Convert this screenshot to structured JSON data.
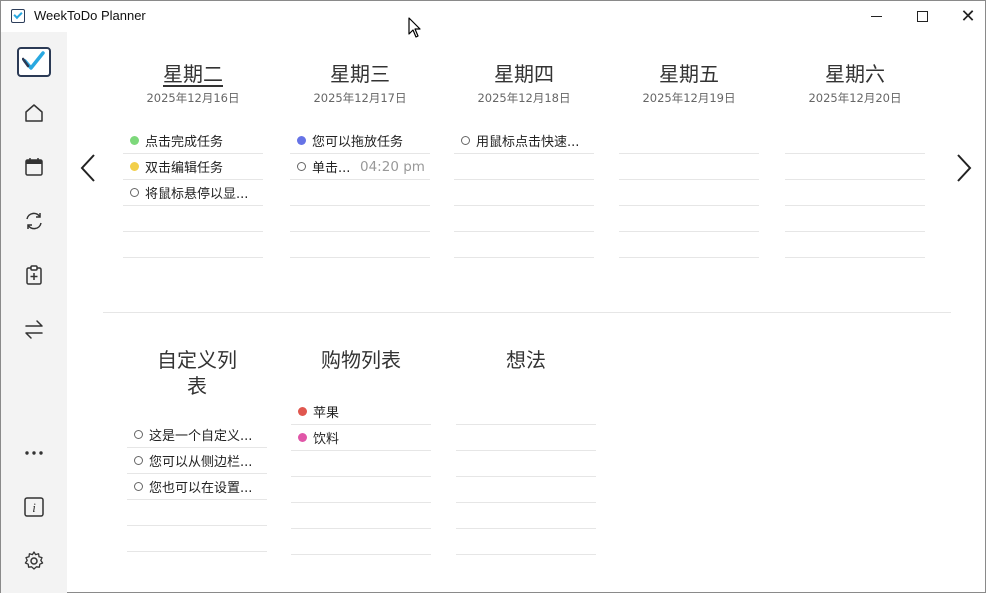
{
  "window": {
    "title": "WeekToDo Planner"
  },
  "sidebar": {
    "items": [
      {
        "name": "home-icon"
      },
      {
        "name": "calendar-icon"
      },
      {
        "name": "sync-icon"
      },
      {
        "name": "clipboard-add-icon"
      },
      {
        "name": "swap-arrows-icon"
      },
      {
        "name": "more-icon"
      },
      {
        "name": "info-icon"
      },
      {
        "name": "settings-icon"
      }
    ]
  },
  "week": {
    "days": [
      {
        "name": "星期二",
        "date": "2025年12月16日",
        "today": true,
        "tasks": [
          {
            "text": "点击完成任务",
            "marker": "dot",
            "color": "#7dd87b"
          },
          {
            "text": "双击编辑任务",
            "marker": "dot",
            "color": "#f2cf4a"
          },
          {
            "text": "将鼠标悬停以显...",
            "marker": "circle",
            "color": ""
          }
        ]
      },
      {
        "name": "星期三",
        "date": "2025年12月17日",
        "today": false,
        "tasks": [
          {
            "text": "您可以拖放任务",
            "marker": "dot",
            "color": "#6673e6"
          },
          {
            "text": "单击...",
            "marker": "circle",
            "color": "",
            "time": "04:20 pm"
          }
        ]
      },
      {
        "name": "星期四",
        "date": "2025年12月18日",
        "today": false,
        "tasks": [
          {
            "text": "用鼠标点击快速...",
            "marker": "circle",
            "color": ""
          }
        ]
      },
      {
        "name": "星期五",
        "date": "2025年12月19日",
        "today": false,
        "tasks": []
      },
      {
        "name": "星期六",
        "date": "2025年12月20日",
        "today": false,
        "tasks": []
      }
    ]
  },
  "lists": [
    {
      "name_line1": "自定义列",
      "name_line2": "表",
      "tasks": [
        {
          "text": "这是一个自定义...",
          "marker": "circle",
          "color": ""
        },
        {
          "text": "您可以从侧边栏...",
          "marker": "circle",
          "color": ""
        },
        {
          "text": "您也可以在设置...",
          "marker": "circle",
          "color": ""
        }
      ]
    },
    {
      "name_line1": "购物列表",
      "name_line2": "",
      "tasks": [
        {
          "text": "苹果",
          "marker": "dot",
          "color": "#e0574f"
        },
        {
          "text": "饮料",
          "marker": "dot",
          "color": "#e056a8"
        }
      ]
    },
    {
      "name_line1": "想法",
      "name_line2": "",
      "tasks": []
    }
  ],
  "colors": {
    "sidebar_bg": "#f3f3f3",
    "logo_border": "#2b3a55",
    "logo_check": "#29a8e0",
    "divider": "#e6e6e6"
  }
}
